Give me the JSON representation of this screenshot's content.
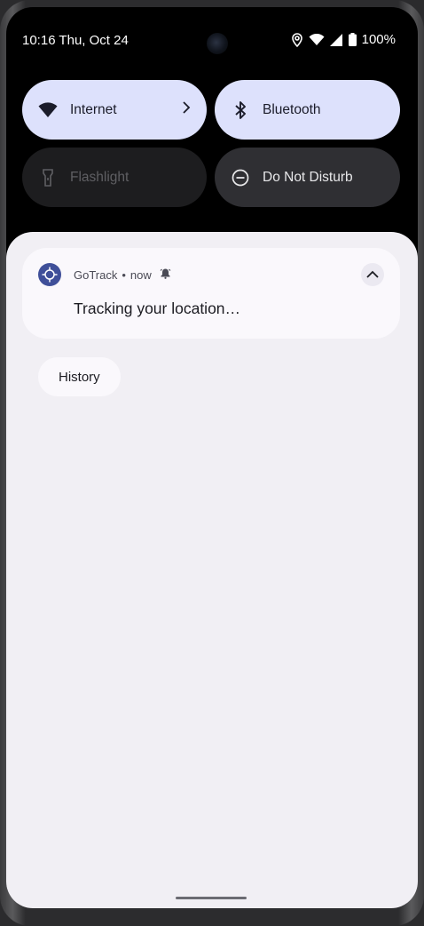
{
  "status_bar": {
    "time_date": "10:16 Thu, Oct 24",
    "battery": "100%",
    "icons": [
      "location-icon",
      "wifi-icon",
      "signal-icon",
      "battery-icon"
    ]
  },
  "quick_settings": {
    "tiles": [
      {
        "label": "Internet",
        "icon": "wifi-icon",
        "state": "on"
      },
      {
        "label": "Bluetooth",
        "icon": "bluetooth-icon",
        "state": "on"
      },
      {
        "label": "Flashlight",
        "icon": "flashlight-icon",
        "state": "unavailable"
      },
      {
        "label": "Do Not Disturb",
        "icon": "dnd-icon",
        "state": "off"
      }
    ]
  },
  "notification": {
    "app_name": "GoTrack",
    "separator": "•",
    "time": "now",
    "text": "Tracking your location…"
  },
  "history_button": {
    "label": "History"
  },
  "colors": {
    "tile_on": "#dde1fc",
    "tile_off": "#1d1d1f",
    "tile_dnd": "#2f2f33",
    "sheet": "#f1eff4",
    "app_icon": "#3f4f99"
  }
}
